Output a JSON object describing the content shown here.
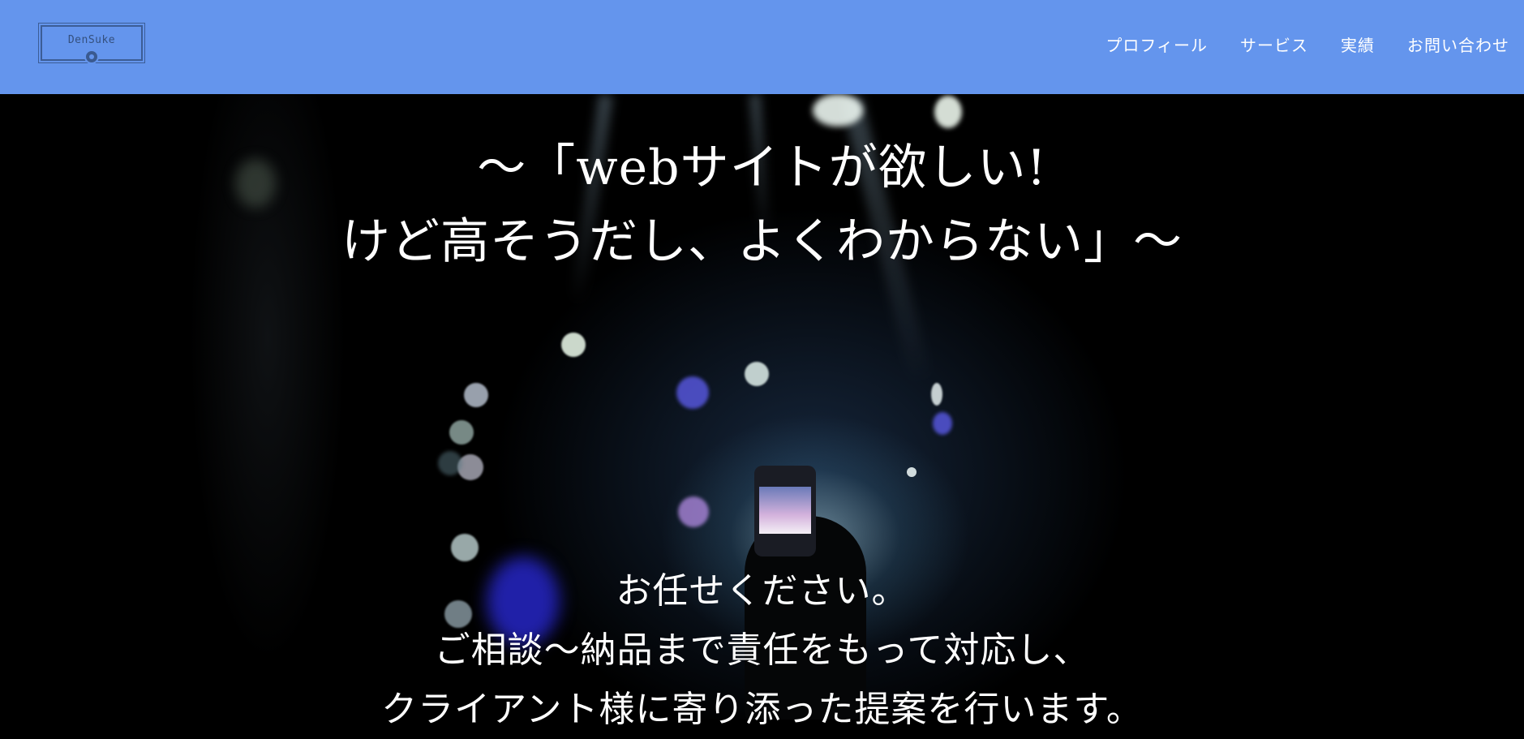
{
  "header": {
    "logo_text": "DenSuke",
    "nav": [
      {
        "label": "プロフィール"
      },
      {
        "label": "サービス"
      },
      {
        "label": "実績"
      },
      {
        "label": "お問い合わせ"
      }
    ],
    "background_color": "#6495ed"
  },
  "hero": {
    "headline_lines": [
      "〜「webサイトが欲しい!",
      "けど高そうだし、よくわからない」〜"
    ],
    "body_lines": [
      "お任せください。",
      "ご相談〜納品まで責任をもって対応し、",
      "クライアント様に寄り添った提案を行います。"
    ],
    "text_color": "#ffffff"
  }
}
